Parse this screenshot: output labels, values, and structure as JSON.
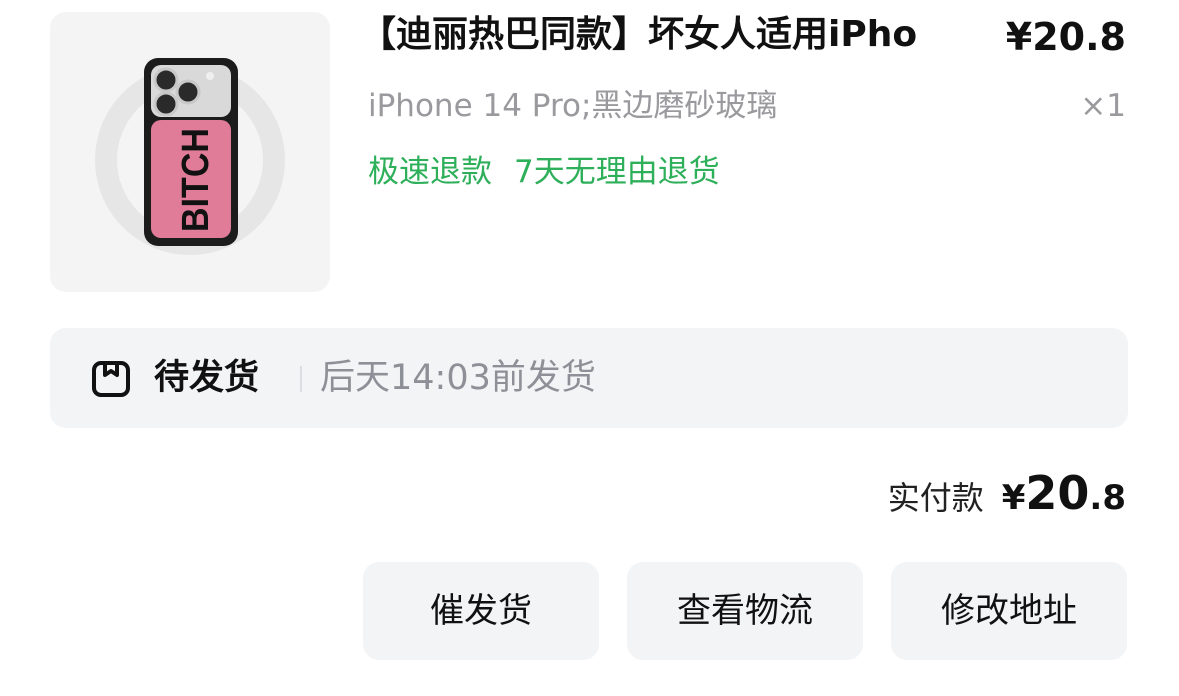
{
  "product": {
    "title": "【迪丽热巴同款】坏女人适用iPho",
    "price": "¥20.8",
    "sku": "iPhone 14 Pro;黑边磨砂玻璃",
    "quantity": "×1",
    "tags": [
      "极速退款",
      "7天无理由退货"
    ],
    "image_icon": "phone-case-image",
    "case_text": "BITCH"
  },
  "status": {
    "icon": "package-box-icon",
    "state": "待发货",
    "eta": "后天14:03前发货"
  },
  "payment": {
    "label": "实付款",
    "currency": "¥",
    "amount_int": "20",
    "amount_dec": ".8"
  },
  "actions": {
    "urge": "催发货",
    "logistics": "查看物流",
    "address": "修改地址"
  },
  "colors": {
    "tag_green": "#2eaf5a",
    "muted_gray": "#9a9a9e",
    "button_bg": "#f3f4f6",
    "case_pink": "#e07b98"
  }
}
